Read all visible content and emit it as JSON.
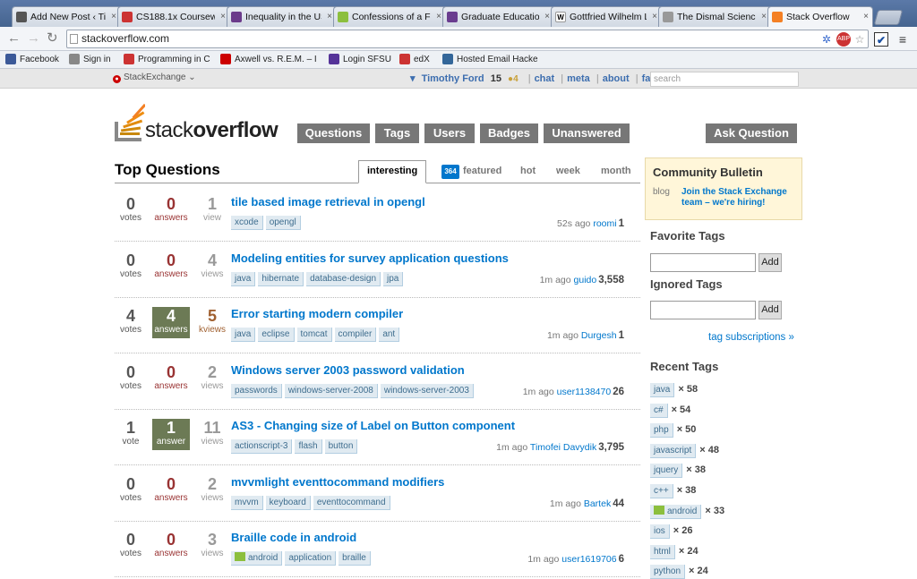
{
  "browser": {
    "tabs": [
      {
        "title": "Add New Post ‹ Tim",
        "favicon": "blog-icon",
        "color": "#555555"
      },
      {
        "title": "CS188.1x Coursew",
        "favicon": "edx-icon",
        "color": "#cc3333"
      },
      {
        "title": "Inequality in the US",
        "favicon": "chart-icon",
        "color": "#6b3b8a"
      },
      {
        "title": "Confessions of a Fo",
        "favicon": "lv-icon",
        "color": "#8cbf3e"
      },
      {
        "title": "Graduate Education",
        "favicon": "w-icon",
        "color": "#6a3d8f"
      },
      {
        "title": "Gottfried Wilhelm L",
        "favicon": "wikipedia-icon",
        "color": "#ffffff"
      },
      {
        "title": "The Dismal Science",
        "favicon": "blog-icon",
        "color": "#999999"
      },
      {
        "title": "Stack Overflow",
        "favicon": "stackoverflow-icon",
        "color": "#f48024"
      }
    ],
    "url": "stackoverflow.com",
    "bookmarks": [
      {
        "label": "Facebook",
        "icon": "facebook-icon",
        "color": "#3b5998"
      },
      {
        "label": "Sign in",
        "icon": "page-icon",
        "color": "#888888"
      },
      {
        "label": "Programming in C",
        "icon": "c-icon",
        "color": "#cc3333"
      },
      {
        "label": "Axwell vs. R.E.M. – I",
        "icon": "youtube-icon",
        "color": "#cc0000"
      },
      {
        "label": "Login SFSU",
        "icon": "sfsu-icon",
        "color": "#553399"
      },
      {
        "label": "edX",
        "icon": "edx-icon",
        "color": "#cc3333"
      },
      {
        "label": "Hosted Email Hacke",
        "icon": "shield-icon",
        "color": "#336699"
      }
    ]
  },
  "sebar": {
    "logo_text": "StackExchange",
    "user": "Timothy Ford",
    "rep": "15",
    "badge": "●4",
    "links": [
      "chat",
      "meta",
      "about",
      "faq"
    ],
    "search_placeholder": "search"
  },
  "site": {
    "logo_light": "stack",
    "logo_bold": "overflow",
    "nav": [
      "Questions",
      "Tags",
      "Users",
      "Badges",
      "Unanswered"
    ],
    "ask": "Ask Question",
    "page_title": "Top Questions",
    "tabs": {
      "interesting": "interesting",
      "featured_count": "364",
      "featured": "featured",
      "hot": "hot",
      "week": "week",
      "month": "month"
    }
  },
  "questions": [
    {
      "votes": "0",
      "votes_label": "votes",
      "answers": "0",
      "answers_label": "answers",
      "accepted": false,
      "views": "1",
      "views_label": "view",
      "title": "tile based image retrieval in opengl",
      "tags": [
        "xcode",
        "opengl"
      ],
      "time": "52s ago",
      "user": "roomi",
      "rep": "1"
    },
    {
      "votes": "0",
      "votes_label": "votes",
      "answers": "0",
      "answers_label": "answers",
      "accepted": false,
      "views": "4",
      "views_label": "views",
      "title": "Modeling entities for survey application questions",
      "tags": [
        "java",
        "hibernate",
        "database-design",
        "jpa"
      ],
      "time": "1m ago",
      "user": "guido",
      "rep": "3,558"
    },
    {
      "votes": "4",
      "votes_label": "votes",
      "answers": "4",
      "answers_label": "answers",
      "accepted": true,
      "views": "5",
      "views_label": "kviews",
      "title": "Error starting modern compiler",
      "tags": [
        "java",
        "eclipse",
        "tomcat",
        "compiler",
        "ant"
      ],
      "time": "1m ago",
      "user": "Durgesh",
      "rep": "1"
    },
    {
      "votes": "0",
      "votes_label": "votes",
      "answers": "0",
      "answers_label": "answers",
      "accepted": false,
      "views": "2",
      "views_label": "views",
      "title": "Windows server 2003 password validation",
      "tags": [
        "passwords",
        "windows-server-2008",
        "windows-server-2003"
      ],
      "time": "1m ago",
      "user": "user1138470",
      "rep": "26"
    },
    {
      "votes": "1",
      "votes_label": "vote",
      "answers": "1",
      "answers_label": "answer",
      "accepted": true,
      "views": "11",
      "views_label": "views",
      "title": "AS3 - Changing size of Label on Button component",
      "tags": [
        "actionscript-3",
        "flash",
        "button"
      ],
      "time": "1m ago",
      "user": "Timofei Davydik",
      "rep": "3,795"
    },
    {
      "votes": "0",
      "votes_label": "votes",
      "answers": "0",
      "answers_label": "answers",
      "accepted": false,
      "views": "2",
      "views_label": "views",
      "title": "mvvmlight eventtocommand modifiers",
      "tags": [
        "mvvm",
        "keyboard",
        "eventtocommand"
      ],
      "time": "1m ago",
      "user": "Bartek",
      "rep": "44"
    },
    {
      "votes": "0",
      "votes_label": "votes",
      "answers": "0",
      "answers_label": "answers",
      "accepted": false,
      "views": "3",
      "views_label": "views",
      "title": "Braille code in android",
      "tags": [
        "android",
        "application",
        "braille"
      ],
      "time": "1m ago",
      "user": "user1619706",
      "rep": "6"
    }
  ],
  "sidebar": {
    "bulletin_title": "Community Bulletin",
    "bulletin_kind": "blog",
    "bulletin_text": "Join the Stack Exchange team – we're hiring!",
    "favorite_tags": "Favorite Tags",
    "ignored_tags": "Ignored Tags",
    "add_label": "Add",
    "tag_subscriptions": "tag subscriptions »",
    "recent_tags_title": "Recent Tags",
    "recent_tags": [
      {
        "name": "java",
        "count": "× 58"
      },
      {
        "name": "c#",
        "count": "× 54"
      },
      {
        "name": "php",
        "count": "× 50"
      },
      {
        "name": "javascript",
        "count": "× 48"
      },
      {
        "name": "jquery",
        "count": "× 38"
      },
      {
        "name": "c++",
        "count": "× 38"
      },
      {
        "name": "android",
        "count": "× 33"
      },
      {
        "name": "ios",
        "count": "× 26"
      },
      {
        "name": "html",
        "count": "× 24"
      },
      {
        "name": "python",
        "count": "× 24"
      }
    ]
  },
  "colors": {
    "accent": "#0077cc",
    "nav": "#777777",
    "accepted": "#6c7a55"
  }
}
